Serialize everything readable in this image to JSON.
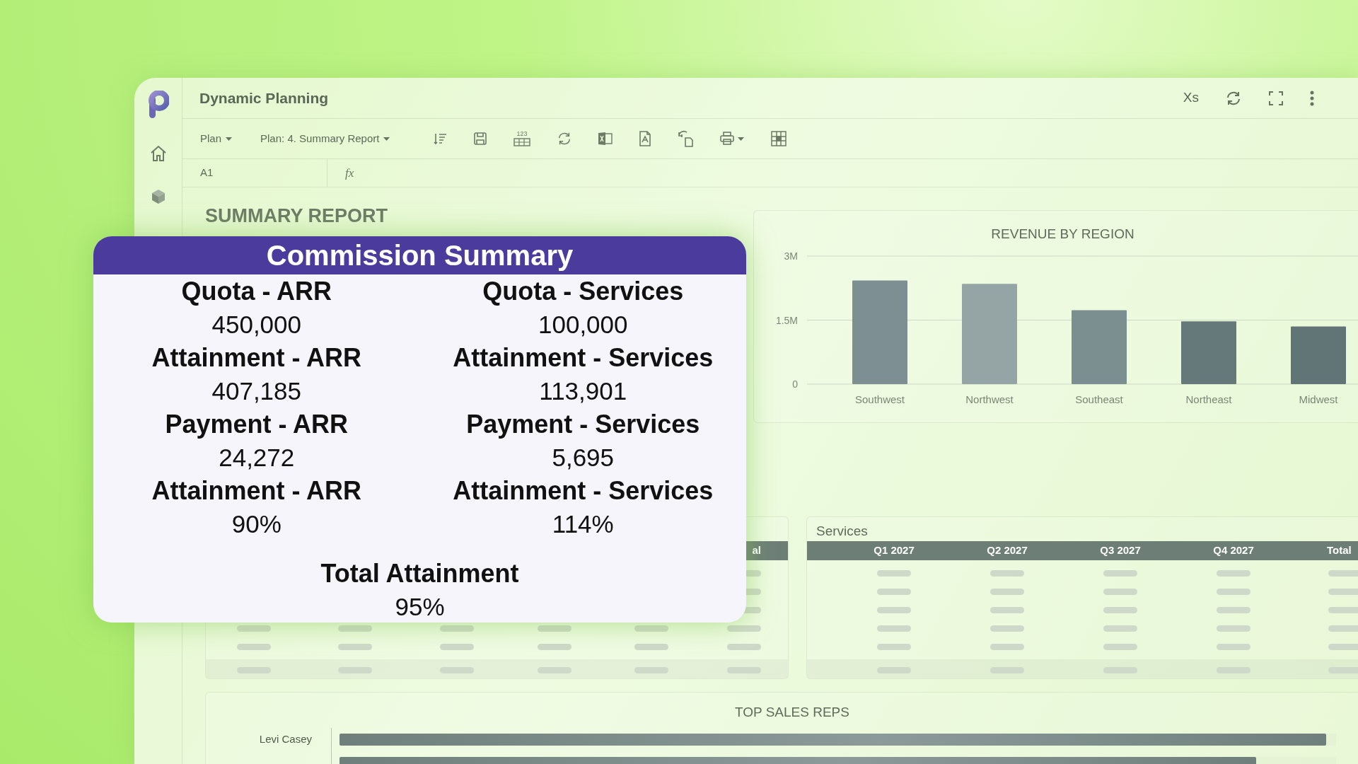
{
  "app": {
    "title": "Dynamic Planning",
    "user_initials": "Xs"
  },
  "toolbar": {
    "menus": [
      {
        "label": "Plan"
      },
      {
        "label": "Plan: 4. Summary Report"
      }
    ],
    "number_icon_label": "123"
  },
  "formula_bar": {
    "cell": "A1",
    "function_label": "fx"
  },
  "report": {
    "title": "SUMMARY REPORT"
  },
  "revenue_chart": {
    "chart_data": {
      "type": "bar",
      "title": "REVENUE BY REGION",
      "categories": [
        "Southwest",
        "Northwest",
        "Southeast",
        "Northeast",
        "Midwest"
      ],
      "values": [
        2430000,
        2350000,
        1730000,
        1470000,
        1350000
      ],
      "ylim": [
        0,
        3000000
      ],
      "yticks": [
        {
          "value": 0,
          "label": "0"
        },
        {
          "value": 1500000,
          "label": "1.5M"
        },
        {
          "value": 3000000,
          "label": "3M"
        }
      ]
    }
  },
  "left_table": {
    "header_fragment": "al",
    "rows": [
      {
        "kind": "placeholder"
      },
      {
        "kind": "placeholder"
      },
      {
        "kind": "placeholder"
      },
      {
        "kind": "placeholder"
      },
      {
        "kind": "placeholder"
      },
      {
        "kind": "total"
      }
    ]
  },
  "services": {
    "title": "Services",
    "columns": [
      "Q1 2027",
      "Q2 2027",
      "Q3 2027",
      "Q4 2027",
      "Total"
    ],
    "rows": [
      {
        "kind": "placeholder"
      },
      {
        "kind": "placeholder"
      },
      {
        "kind": "placeholder"
      },
      {
        "kind": "placeholder"
      },
      {
        "kind": "placeholder"
      },
      {
        "kind": "total"
      }
    ]
  },
  "top_sales_reps": {
    "title": "TOP SALES REPS",
    "reps": [
      {
        "name": "Levi Casey",
        "level": 0.99
      },
      {
        "level": 0.92
      }
    ]
  },
  "commission_summary": {
    "title": "Commission Summary",
    "metrics": [
      {
        "label": "Quota - ARR",
        "value": "450,000"
      },
      {
        "label": "Quota - Services",
        "value": "100,000"
      },
      {
        "label": "Attainment - ARR",
        "value": "407,185"
      },
      {
        "label": "Attainment - Services",
        "value": "113,901"
      },
      {
        "label": "Payment - ARR",
        "value": "24,272"
      },
      {
        "label": "Payment - Services",
        "value": "5,695"
      },
      {
        "label": "Attainment - ARR",
        "value": "90%"
      },
      {
        "label": "Attainment - Services",
        "value": "114%"
      }
    ],
    "total": {
      "label": "Total Attainment",
      "value": "95%"
    }
  }
}
